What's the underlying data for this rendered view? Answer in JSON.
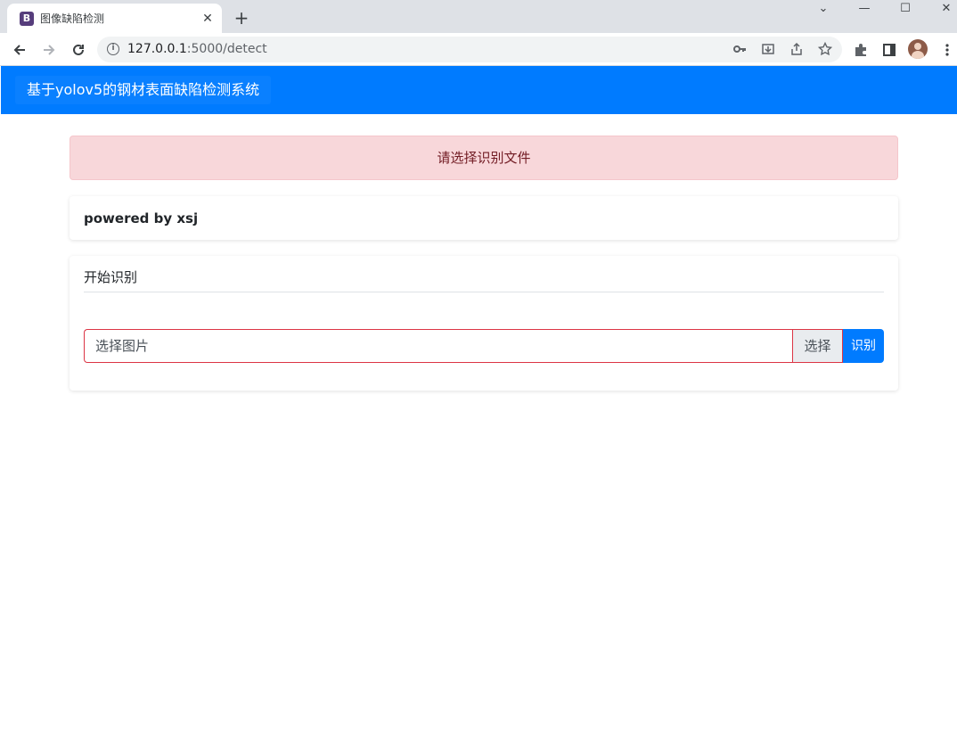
{
  "browser": {
    "tab_favicon": "B",
    "tab_title": "图像缺陷检测",
    "tab_close": "✕",
    "new_tab": "+",
    "url_host": "127.0.0.1",
    "url_rest": ":5000/detect",
    "window_controls": {
      "minimize": "—",
      "maximize": "☐",
      "close": "✕",
      "tabsearch": "⌄"
    },
    "icons": {
      "back": "arrow-left-icon",
      "forward": "arrow-right-icon",
      "reload": "reload-icon",
      "site_info": "info-icon",
      "password_key": "key-icon",
      "install": "install-icon",
      "share": "share-icon",
      "bookmark": "star-icon",
      "extensions": "puzzle-icon",
      "side_panel": "side-panel-icon",
      "profile": "avatar-icon",
      "menu": "kebab-menu-icon"
    }
  },
  "navbar": {
    "brand": "基于yolov5的钢材表面缺陷检测系统",
    "color": "#007bff"
  },
  "alert": {
    "message": "请选择识别文件",
    "background": "#f8d7da",
    "text_color": "#721c24"
  },
  "powered_card": {
    "text": "powered by xsj"
  },
  "detect_card": {
    "title": "开始识别",
    "file_input": {
      "label": "选择图片",
      "browse_label": "选择",
      "border_color": "#dc3545"
    },
    "submit_label": "识别"
  }
}
